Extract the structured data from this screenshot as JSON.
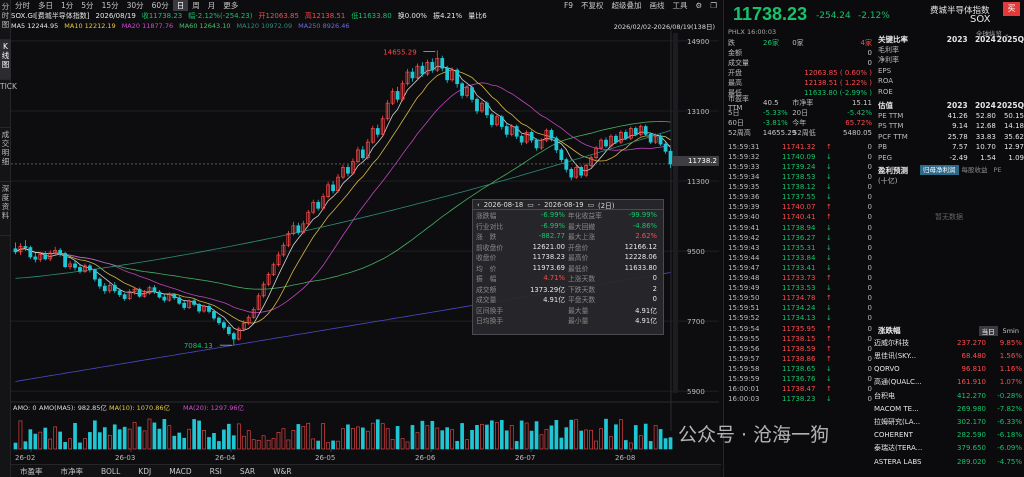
{
  "leftbar": [
    "分时图",
    "K线图",
    "TICK",
    "成交明细",
    "深度资料"
  ],
  "toolbar": {
    "items": [
      "分时",
      "多日",
      "1分",
      "5分",
      "15分",
      "30分",
      "60分",
      "日",
      "周",
      "月",
      "更多"
    ],
    "active": "日",
    "right": [
      "F9",
      "不复权",
      "超级叠加",
      "画线",
      "工具",
      "⚙",
      "❐"
    ]
  },
  "infoline": {
    "code": "SOX.GI[费城半导体指数]",
    "date": "2026/08/19",
    "close": "收11738.23",
    "change": "幅-2.12%(-254.23)",
    "open": "开12063.85",
    "high": "高12138.51",
    "low": "低11633.80",
    "turnover": "换0.00%",
    "amp": "振4.21%",
    "volratio": "量比6"
  },
  "maline": {
    "ma5": "MA5 12244.95",
    "ma10": "MA10 12212.19",
    "ma20": "MA20 11877.76",
    "ma60": "MA60 12643.10",
    "ma120": "MA120 10972.09",
    "ma250": "MA250 8926.46",
    "range": "2026/02/02-2026/08/19(138日)"
  },
  "chart_data": {
    "type": "candlestick",
    "ylim": [
      5700,
      15000
    ],
    "yticks": [
      14900,
      13100,
      11300,
      9500,
      7700,
      5900
    ],
    "xlabels": [
      "26-02",
      "26-03",
      "26-04",
      "26-05",
      "26-06",
      "26-07",
      "26-08"
    ],
    "max_label": "14655.29",
    "min_label": "7084.13",
    "current": "11738.2",
    "candles": [
      [
        9560,
        9480,
        9720,
        9420
      ],
      [
        9480,
        9620,
        9700,
        9400
      ],
      [
        9620,
        9590,
        9780,
        9510
      ],
      [
        9590,
        9350,
        9640,
        9300
      ],
      [
        9350,
        9290,
        9450,
        9210
      ],
      [
        9290,
        9410,
        9480,
        9220
      ],
      [
        9410,
        9300,
        9500,
        9260
      ],
      [
        9300,
        9450,
        9520,
        9240
      ],
      [
        9450,
        9520,
        9610,
        9380
      ],
      [
        9520,
        9440,
        9580,
        9360
      ],
      [
        9440,
        9100,
        9480,
        9060
      ],
      [
        9100,
        9170,
        9250,
        9030
      ],
      [
        9170,
        9080,
        9260,
        9000
      ],
      [
        9080,
        8980,
        9150,
        8920
      ],
      [
        8980,
        9120,
        9180,
        8940
      ],
      [
        9120,
        9020,
        9170,
        8950
      ],
      [
        9020,
        8780,
        9050,
        8720
      ],
      [
        8780,
        8600,
        8830,
        8530
      ],
      [
        8600,
        8480,
        8680,
        8400
      ],
      [
        8480,
        8620,
        8690,
        8420
      ],
      [
        8620,
        8480,
        8700,
        8420
      ],
      [
        8480,
        8380,
        8540,
        8320
      ],
      [
        8380,
        8280,
        8420,
        8220
      ],
      [
        8280,
        8460,
        8520,
        8240
      ],
      [
        8460,
        8520,
        8580,
        8380
      ],
      [
        8520,
        8340,
        8560,
        8300
      ],
      [
        8340,
        8420,
        8500,
        8300
      ],
      [
        8420,
        8560,
        8610,
        8380
      ],
      [
        8560,
        8450,
        8630,
        8400
      ],
      [
        8450,
        8320,
        8500,
        8280
      ],
      [
        8320,
        8240,
        8380,
        8180
      ],
      [
        8240,
        8380,
        8440,
        8200
      ],
      [
        8380,
        8300,
        8420,
        8250
      ],
      [
        8300,
        8160,
        8350,
        8120
      ],
      [
        8160,
        8050,
        8220,
        7990
      ],
      [
        8050,
        8220,
        8260,
        8010
      ],
      [
        8220,
        8130,
        8280,
        8080
      ],
      [
        8130,
        7960,
        8170,
        7900
      ],
      [
        7960,
        8080,
        8120,
        7920
      ],
      [
        8080,
        7950,
        8130,
        7900
      ],
      [
        7950,
        7780,
        8000,
        7720
      ],
      [
        7780,
        7660,
        7820,
        7600
      ],
      [
        7660,
        7540,
        7720,
        7480
      ],
      [
        7540,
        7380,
        7600,
        7330
      ],
      [
        7380,
        7240,
        7430,
        7084
      ],
      [
        7240,
        7500,
        7560,
        7200
      ],
      [
        7500,
        7650,
        7720,
        7440
      ],
      [
        7650,
        7800,
        7860,
        7600
      ],
      [
        7800,
        8000,
        8060,
        7760
      ],
      [
        8000,
        8350,
        8420,
        7980
      ],
      [
        8350,
        8650,
        8720,
        8300
      ],
      [
        8650,
        8900,
        8960,
        8600
      ],
      [
        8900,
        9150,
        9210,
        8860
      ],
      [
        9150,
        9400,
        9480,
        9100
      ],
      [
        9400,
        9650,
        9720,
        9350
      ],
      [
        9650,
        9950,
        10020,
        9600
      ],
      [
        9950,
        10150,
        10250,
        9900
      ],
      [
        10150,
        9980,
        10230,
        9920
      ],
      [
        9980,
        10200,
        10280,
        9950
      ],
      [
        10200,
        10500,
        10560,
        10150
      ],
      [
        10500,
        10750,
        10820,
        10450
      ],
      [
        10750,
        10600,
        10820,
        10540
      ],
      [
        10600,
        10900,
        10980,
        10560
      ],
      [
        10900,
        11200,
        11280,
        10850
      ],
      [
        11200,
        11050,
        11300,
        10980
      ],
      [
        11050,
        11400,
        11480,
        11000
      ],
      [
        11400,
        11650,
        11720,
        11350
      ],
      [
        11650,
        11500,
        11720,
        11420
      ],
      [
        11500,
        11800,
        11880,
        11450
      ],
      [
        11800,
        12100,
        12180,
        11750
      ],
      [
        12100,
        11900,
        12200,
        11850
      ],
      [
        11900,
        12300,
        12380,
        11850
      ],
      [
        12300,
        12650,
        12720,
        12250
      ],
      [
        12650,
        12500,
        12750,
        12420
      ],
      [
        12500,
        12900,
        12980,
        12450
      ],
      [
        12900,
        13300,
        13380,
        12850
      ],
      [
        13300,
        13600,
        13680,
        13250
      ],
      [
        13600,
        13400,
        13720,
        13320
      ],
      [
        13400,
        13800,
        13880,
        13350
      ],
      [
        13800,
        14100,
        14180,
        13750
      ],
      [
        14100,
        13950,
        14200,
        13850
      ],
      [
        13950,
        14250,
        14320,
        13900
      ],
      [
        14250,
        14050,
        14350,
        13980
      ],
      [
        14050,
        14350,
        14420,
        14000
      ],
      [
        14350,
        14150,
        14450,
        14080
      ],
      [
        14150,
        14450,
        14655,
        14100
      ],
      [
        14450,
        14200,
        14520,
        14120
      ],
      [
        14200,
        13900,
        14260,
        13820
      ],
      [
        13900,
        14150,
        14220,
        13850
      ],
      [
        14150,
        13800,
        14200,
        13700
      ],
      [
        13800,
        13500,
        13850,
        13420
      ],
      [
        13500,
        13700,
        13760,
        13440
      ],
      [
        13700,
        13400,
        13750,
        13320
      ],
      [
        13400,
        13100,
        13450,
        13020
      ],
      [
        13100,
        13300,
        13360,
        13050
      ],
      [
        13300,
        13000,
        13350,
        12920
      ],
      [
        13000,
        12750,
        13050,
        12680
      ],
      [
        12750,
        12950,
        13000,
        12700
      ],
      [
        12950,
        12700,
        13000,
        12620
      ],
      [
        12700,
        12500,
        12760,
        12420
      ],
      [
        12500,
        12700,
        12760,
        12450
      ],
      [
        12700,
        12450,
        12750,
        12380
      ],
      [
        12450,
        12300,
        12500,
        12220
      ],
      [
        12300,
        12550,
        12600,
        12250
      ],
      [
        12550,
        12350,
        12600,
        12280
      ],
      [
        12350,
        12150,
        12400,
        12080
      ],
      [
        12150,
        12350,
        12400,
        12100
      ],
      [
        12350,
        12600,
        12650,
        12300
      ],
      [
        12600,
        12400,
        12650,
        12320
      ],
      [
        12400,
        12100,
        12450,
        12020
      ],
      [
        12100,
        11850,
        12150,
        11780
      ],
      [
        11850,
        11600,
        11900,
        11520
      ],
      [
        11600,
        11400,
        11650,
        11320
      ],
      [
        11400,
        11650,
        11700,
        11350
      ],
      [
        11650,
        11450,
        11700,
        11380
      ],
      [
        11450,
        11700,
        11750,
        11400
      ],
      [
        11700,
        11900,
        11960,
        11650
      ],
      [
        11900,
        12150,
        12200,
        11850
      ],
      [
        12150,
        12350,
        12400,
        12100
      ],
      [
        12350,
        12200,
        12420,
        12150
      ],
      [
        12200,
        12450,
        12500,
        12150
      ],
      [
        12450,
        12300,
        12500,
        12250
      ],
      [
        12300,
        12550,
        12600,
        12250
      ],
      [
        12550,
        12400,
        12620,
        12350
      ],
      [
        12400,
        12650,
        12700,
        12350
      ],
      [
        12650,
        12500,
        12700,
        12450
      ],
      [
        12500,
        12700,
        12750,
        12450
      ],
      [
        12700,
        12500,
        12750,
        12450
      ],
      [
        12500,
        12300,
        12550,
        12250
      ],
      [
        12300,
        12450,
        12520,
        12250
      ],
      [
        12450,
        12250,
        12500,
        12200
      ],
      [
        12250,
        12063,
        12300,
        12000
      ],
      [
        12063,
        11738,
        12138,
        11633
      ]
    ],
    "volume": {
      "label": "AMO: 0",
      "ma5": "AMO(MA5): 982.85亿",
      "ma10": "MA(10): 1070.86亿",
      "ma20": "MA(20): 1297.96亿"
    }
  },
  "tooltip": {
    "from": "2026-08-18",
    "to": "2026-08-19",
    "days": "(2日)",
    "rows": [
      [
        "涨跌幅",
        "-6.99%",
        "年化收益率",
        "-99.99%"
      ],
      [
        "行业对比",
        "-6.99%",
        "最大回撤",
        "-4.86%"
      ],
      [
        "涨　跌",
        "-882.77",
        "最大上涨",
        "2.62%"
      ],
      [
        "前收盘价",
        "12621.00",
        "开盘价",
        "12166.12"
      ],
      [
        "收盘价",
        "11738.23",
        "最高价",
        "12228.06"
      ],
      [
        "均　价",
        "11973.69",
        "最低价",
        "11633.80"
      ],
      [
        "振　幅",
        "4.71%",
        "上涨天数",
        "0"
      ],
      [
        "成交额",
        "1373.29亿",
        "下跌天数",
        "2"
      ],
      [
        "成交量",
        "4.91亿",
        "平盘天数",
        "0"
      ],
      [
        "区间换手",
        "",
        "最大量",
        "4.91亿"
      ],
      [
        "日均换手",
        "",
        "最小量",
        "4.91亿"
      ]
    ]
  },
  "bottomtabs": [
    "市盈率",
    "市净率",
    "BOLL",
    "KDJ",
    "MACD",
    "RSI",
    "SAR",
    "W&R"
  ],
  "right": {
    "price": "11738.23",
    "change": "-254.24",
    "pct": "-2.12%",
    "name": "费城半导体指数",
    "code": "SOX",
    "buy": "买",
    "market": "PHLX 16:00:03",
    "ext": "全球纵览 ⌄",
    "stats": [
      [
        "跌",
        "26家",
        "0家",
        "4家"
      ],
      [
        "金额",
        "",
        "",
        "0"
      ],
      [
        "成交量",
        "",
        "",
        "0"
      ],
      [
        "开盘",
        "",
        "",
        "12063.85 ( 0.60% )"
      ],
      [
        "最高",
        "",
        "",
        "12138.51 ( 1.22% )"
      ],
      [
        "最低",
        "",
        "",
        "11633.80 (-2.99% )"
      ],
      [
        "市盈率TTM",
        "40.5",
        "市净率",
        "15.11"
      ],
      [
        "5日",
        "-5.33%",
        "20日",
        "-5.42%"
      ],
      [
        "60日",
        "-3.81%",
        "今年",
        "65.72%"
      ],
      [
        "52周高",
        "14655.29",
        "52周低",
        "5480.05"
      ]
    ],
    "ticks": [
      [
        "15:59:31",
        "11741.32",
        "↑",
        "0"
      ],
      [
        "15:59:32",
        "11740.09",
        "↓",
        "0"
      ],
      [
        "15:59:33",
        "11739.24",
        "↓",
        "0"
      ],
      [
        "15:59:34",
        "11738.53",
        "↓",
        "0"
      ],
      [
        "15:59:35",
        "11738.12",
        "↓",
        "0"
      ],
      [
        "15:59:36",
        "11737.55",
        "↓",
        "0"
      ],
      [
        "15:59:39",
        "11740.07",
        "↑",
        "0"
      ],
      [
        "15:59:40",
        "11740.41",
        "↑",
        "0"
      ],
      [
        "15:59:41",
        "11738.94",
        "↓",
        "0"
      ],
      [
        "15:59:42",
        "11736.27",
        "↓",
        "0"
      ],
      [
        "15:59:43",
        "11735.31",
        "↓",
        "0"
      ],
      [
        "15:59:44",
        "11733.84",
        "↓",
        "0"
      ],
      [
        "15:59:47",
        "11733.41",
        "↓",
        "0"
      ],
      [
        "15:59:48",
        "11733.73",
        "↑",
        "0"
      ],
      [
        "15:59:49",
        "11733.53",
        "↓",
        "0"
      ],
      [
        "15:59:50",
        "11734.78",
        "↑",
        "0"
      ],
      [
        "15:59:51",
        "11734.24",
        "↓",
        "0"
      ],
      [
        "15:59:52",
        "11734.13",
        "↓",
        "0"
      ],
      [
        "15:59:54",
        "11735.95",
        "↑",
        "0"
      ],
      [
        "15:59:55",
        "11738.15",
        "↑",
        "0"
      ],
      [
        "15:59:56",
        "11738.59",
        "↑",
        "0"
      ],
      [
        "15:59:57",
        "11738.86",
        "↑",
        "0"
      ],
      [
        "15:59:58",
        "11738.65",
        "↓",
        "0"
      ],
      [
        "15:59:59",
        "11736.76",
        "↓",
        "0"
      ],
      [
        "16:00:01",
        "11738.47",
        "↑",
        "0"
      ],
      [
        "16:00:03",
        "11738.23",
        "↓",
        "0"
      ]
    ],
    "fin": {
      "title": "关键比率",
      "years": [
        "2023",
        "2024",
        "2025Q"
      ],
      "rows1": [
        [
          "毛利率",
          "",
          "",
          ""
        ],
        [
          "净利率",
          "",
          "",
          ""
        ],
        [
          "EPS",
          "",
          "",
          ""
        ],
        [
          "ROA",
          "",
          "",
          ""
        ],
        [
          "ROE",
          "",
          "",
          ""
        ]
      ],
      "title2": "估值",
      "rows2": [
        [
          "PE TTM",
          "41.26",
          "52.80",
          "50.15"
        ],
        [
          "PS TTM",
          "9.14",
          "12.68",
          "14.18"
        ],
        [
          "PCF TTM",
          "25.78",
          "33.83",
          "35.62"
        ],
        [
          "PB",
          "7.57",
          "10.70",
          "12.97"
        ],
        [
          "PEG",
          "-2.49",
          "1.54",
          "1.09"
        ]
      ],
      "title3": "盈利预测",
      "btn1": "归母净利润",
      "btn2": "每股收益",
      "btn3": "PE",
      "unit": "(十亿)",
      "nodata": "暂无数据"
    },
    "movers": {
      "title": "涨跌幅",
      "tab1": "当日",
      "tab2": "5min",
      "rows": [
        [
          "迈威尔科技",
          "237.270",
          "9.85%"
        ],
        [
          "思佳讯(SKY...",
          "68.480",
          "1.56%"
        ],
        [
          "QORVO",
          "96.810",
          "1.16%"
        ],
        [
          "高通(QUALC...",
          "161.910",
          "1.07%"
        ],
        [
          "台积电",
          "412.270",
          "-0.28%"
        ],
        [
          "MACOM TE...",
          "269.980",
          "-7.82%"
        ],
        [
          "拉姆研究(LA...",
          "302.170",
          "-6.33%"
        ],
        [
          "COHERENT",
          "282.590",
          "-6.18%"
        ],
        [
          "泰瑞达(TERA...",
          "379.650",
          "-6.09%"
        ],
        [
          "ASTERA LABS",
          "289.020",
          "-4.75%"
        ]
      ]
    }
  },
  "watermark": "公众号 · 沧海一狗",
  "colors": {
    "up": "#ff4a4a",
    "down": "#17c26a",
    "ma5": "#e8e8e8",
    "ma10": "#e8c84a",
    "ma20": "#d24ad2",
    "ma60": "#4ac06a",
    "ma120": "#2e8d7a",
    "ma250": "#4a4ac8"
  }
}
